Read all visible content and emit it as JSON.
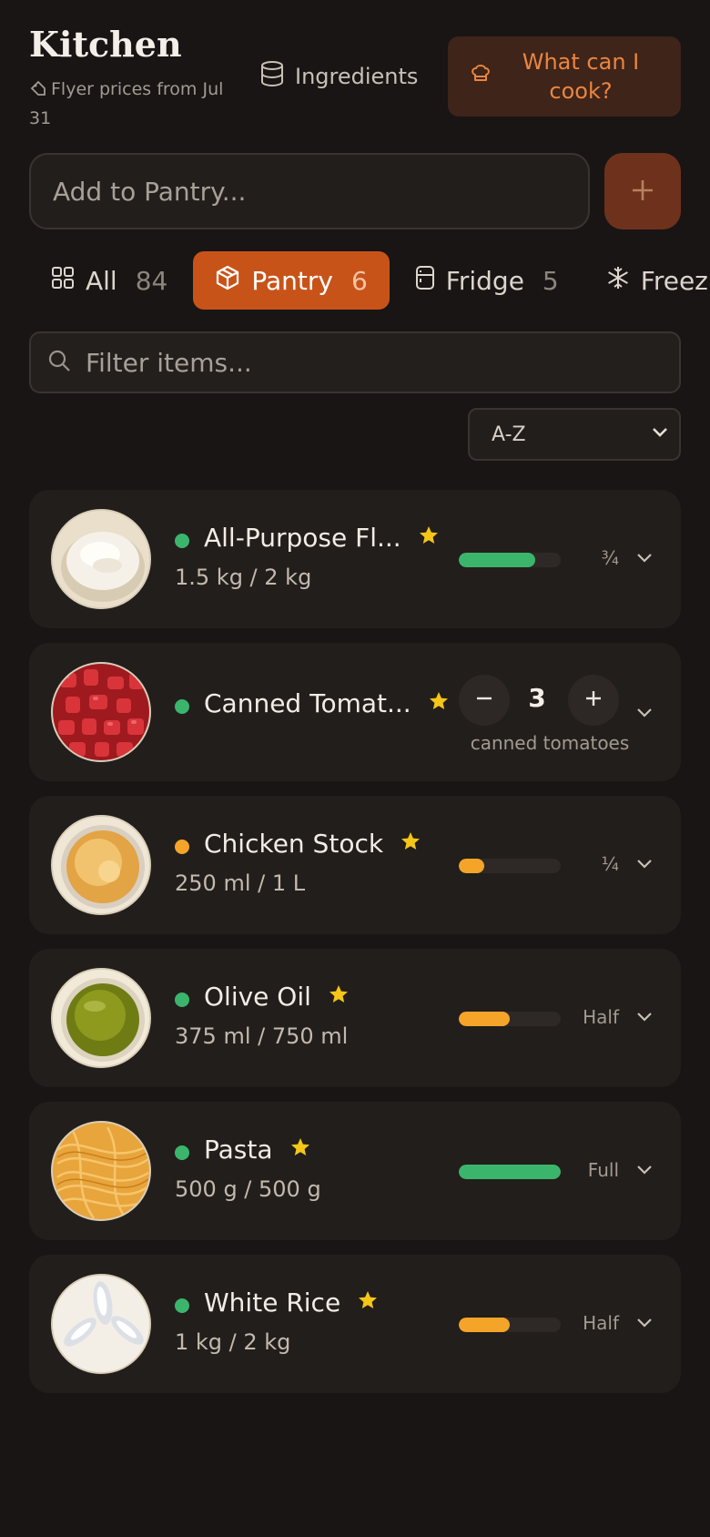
{
  "header": {
    "title": "Kitchen",
    "flyer_text": "Flyer prices from Jul 31",
    "ingredients_label": "Ingredients",
    "cook_label": "What can I cook?"
  },
  "add": {
    "placeholder": "Add to Pantry..."
  },
  "tabs": [
    {
      "label": "All",
      "count": "84",
      "icon": "grid-icon",
      "active": false
    },
    {
      "label": "Pantry",
      "count": "6",
      "icon": "box-icon",
      "active": true
    },
    {
      "label": "Fridge",
      "count": "5",
      "icon": "fridge-icon",
      "active": false
    },
    {
      "label": "Freez",
      "count": "",
      "icon": "snowflake-icon",
      "active": false
    }
  ],
  "filter": {
    "placeholder": "Filter items..."
  },
  "sort": {
    "value": "A-Z"
  },
  "items": [
    {
      "name": "All-Purpose Fl...",
      "qty": "1.5 kg / 2 kg",
      "level_label": "¾",
      "fill_fraction": 0.75,
      "status_color": "#3bb56c",
      "bar_color": "#3bb56c",
      "favorite": true
    },
    {
      "name": "Canned Tomat...",
      "stepper_value": "3",
      "stepper_unit": "canned tomatoes",
      "status_color": "#3bb56c",
      "favorite": true
    },
    {
      "name": "Chicken Stock",
      "qty": "250 ml / 1 L",
      "level_label": "¼",
      "fill_fraction": 0.25,
      "status_color": "#f4a428",
      "bar_color": "#f4a428",
      "favorite": true
    },
    {
      "name": "Olive Oil",
      "qty": "375 ml / 750 ml",
      "level_label": "Half",
      "fill_fraction": 0.5,
      "status_color": "#3bb56c",
      "bar_color": "#f4a428",
      "favorite": true
    },
    {
      "name": "Pasta",
      "qty": "500 g / 500 g",
      "level_label": "Full",
      "fill_fraction": 1.0,
      "status_color": "#3bb56c",
      "bar_color": "#3bb56c",
      "favorite": true
    },
    {
      "name": "White Rice",
      "qty": "1 kg / 2 kg",
      "level_label": "Half",
      "fill_fraction": 0.5,
      "status_color": "#3bb56c",
      "bar_color": "#f4a428",
      "favorite": true
    }
  ],
  "colors": {
    "accent": "#c85319",
    "star": "#f5c518",
    "background": "#181514"
  }
}
